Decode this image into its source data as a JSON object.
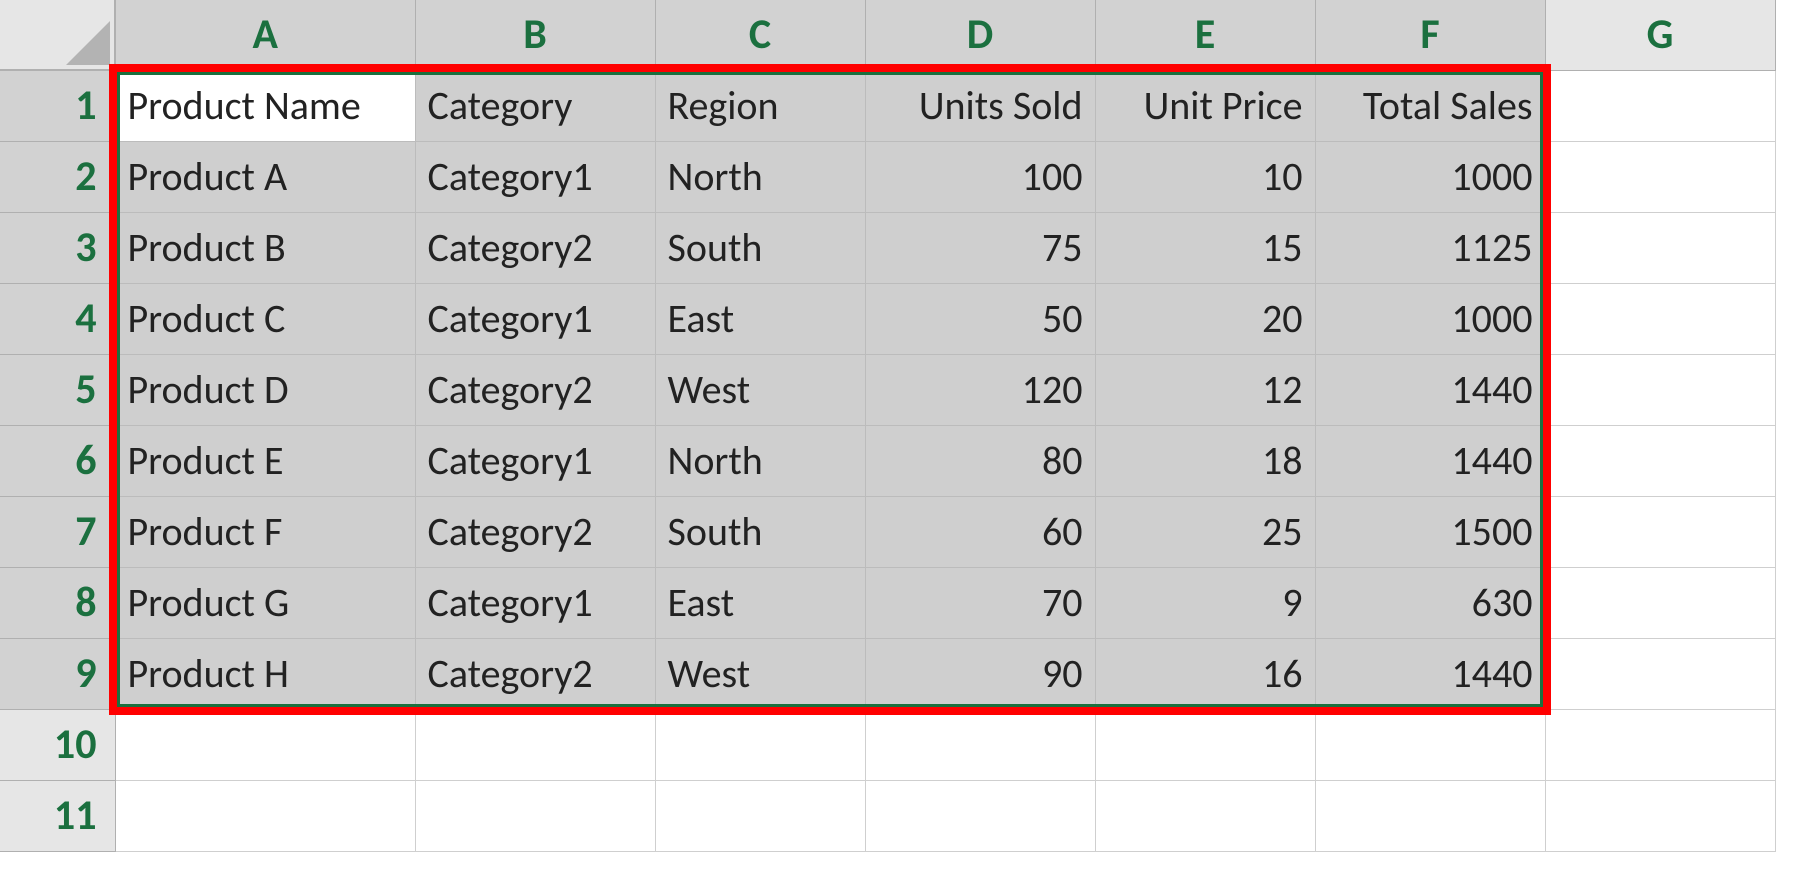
{
  "columns": [
    "A",
    "B",
    "C",
    "D",
    "E",
    "F",
    "G"
  ],
  "visible_row_count": 11,
  "selected_data_cols": 6,
  "selected_data_rows": 9,
  "active_cell": "A1",
  "highlight_color": "#ff0000",
  "marquee_color": "#1b703f",
  "header_row": [
    "Product Name",
    "Category",
    "Region",
    "Units Sold",
    "Unit Price",
    "Total Sales"
  ],
  "data_rows": [
    [
      "Product A",
      "Category1",
      "North",
      "100",
      "10",
      "1000"
    ],
    [
      "Product B",
      "Category2",
      "South",
      "75",
      "15",
      "1125"
    ],
    [
      "Product C",
      "Category1",
      "East",
      "50",
      "20",
      "1000"
    ],
    [
      "Product D",
      "Category2",
      "West",
      "120",
      "12",
      "1440"
    ],
    [
      "Product E",
      "Category1",
      "North",
      "80",
      "18",
      "1440"
    ],
    [
      "Product F",
      "Category2",
      "South",
      "60",
      "25",
      "1500"
    ],
    [
      "Product G",
      "Category1",
      "East",
      "70",
      "9",
      "630"
    ],
    [
      "Product H",
      "Category2",
      "West",
      "90",
      "16",
      "1440"
    ]
  ],
  "numeric_columns": [
    3,
    4,
    5
  ],
  "chart_data": {
    "type": "table",
    "title": "",
    "columns": [
      "Product Name",
      "Category",
      "Region",
      "Units Sold",
      "Unit Price",
      "Total Sales"
    ],
    "rows": [
      {
        "Product Name": "Product A",
        "Category": "Category1",
        "Region": "North",
        "Units Sold": 100,
        "Unit Price": 10,
        "Total Sales": 1000
      },
      {
        "Product Name": "Product B",
        "Category": "Category2",
        "Region": "South",
        "Units Sold": 75,
        "Unit Price": 15,
        "Total Sales": 1125
      },
      {
        "Product Name": "Product C",
        "Category": "Category1",
        "Region": "East",
        "Units Sold": 50,
        "Unit Price": 20,
        "Total Sales": 1000
      },
      {
        "Product Name": "Product D",
        "Category": "Category2",
        "Region": "West",
        "Units Sold": 120,
        "Unit Price": 12,
        "Total Sales": 1440
      },
      {
        "Product Name": "Product E",
        "Category": "Category1",
        "Region": "North",
        "Units Sold": 80,
        "Unit Price": 18,
        "Total Sales": 1440
      },
      {
        "Product Name": "Product F",
        "Category": "Category2",
        "Region": "South",
        "Units Sold": 60,
        "Unit Price": 25,
        "Total Sales": 1500
      },
      {
        "Product Name": "Product G",
        "Category": "Category1",
        "Region": "East",
        "Units Sold": 70,
        "Unit Price": 9,
        "Total Sales": 630
      },
      {
        "Product Name": "Product H",
        "Category": "Category2",
        "Region": "West",
        "Units Sold": 90,
        "Unit Price": 16,
        "Total Sales": 1440
      }
    ]
  }
}
